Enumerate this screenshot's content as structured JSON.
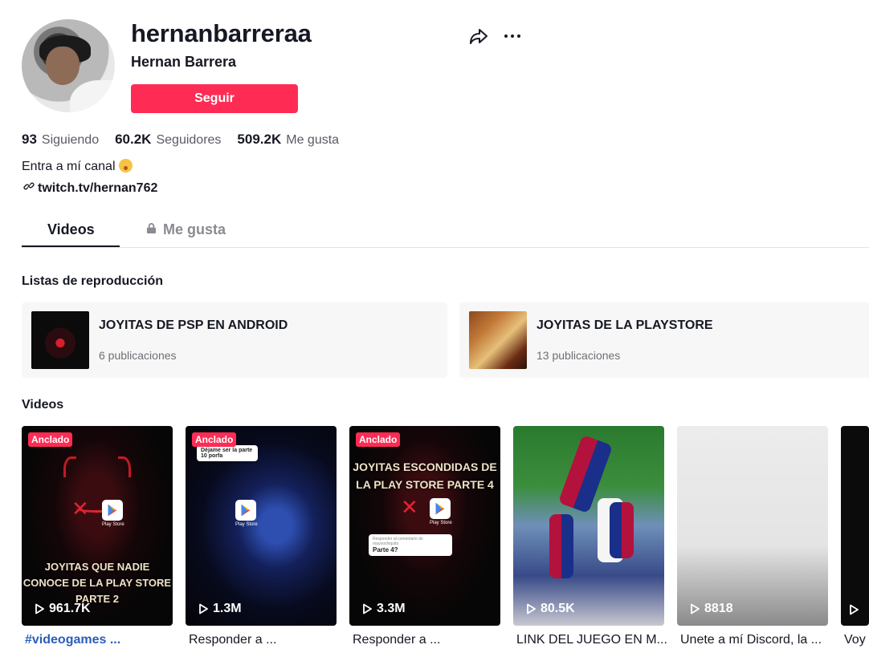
{
  "profile": {
    "username": "hernanbarreraa",
    "display_name": "Hernan Barrera",
    "follow_label": "Seguir",
    "stats": [
      {
        "value": "93",
        "label": "Siguiendo"
      },
      {
        "value": "60.2K",
        "label": "Seguidores"
      },
      {
        "value": "509.2K",
        "label": "Me gusta"
      }
    ],
    "bio": "Entra a mí canal",
    "link": "twitch.tv/hernan762"
  },
  "tabs": [
    {
      "label": "Videos",
      "active": true
    },
    {
      "label": "Me gusta",
      "locked": true
    }
  ],
  "playlists_section": "Listas de reproducción",
  "playlists": [
    {
      "name": "JOYITAS DE PSP EN ANDROID",
      "count": "6 publicaciones"
    },
    {
      "name": "JOYITAS DE LA PLAYSTORE",
      "count": "13 publicaciones"
    }
  ],
  "videos_section": "Videos",
  "videos": [
    {
      "views": "961.7K",
      "title": "#videogames ...",
      "pinned": "Anclado",
      "caption": "JOYITAS QUE NADIE CONOCE DE LA PLAY STORE PARTE 2",
      "store_label": "Play Store"
    },
    {
      "views": "1.3M",
      "title": "Responder a ...",
      "pinned": "Anclado",
      "comment_body": "Déjame ser la parte 10 porfa",
      "store_label": "Play Store"
    },
    {
      "views": "3.3M",
      "title": "Responder a ...",
      "pinned": "Anclado",
      "caption": "JOYITAS ESCONDIDAS DE LA PLAY STORE PARTE 4",
      "comment_head": "Responder al comentario de mayoochiquito",
      "comment_body": "Parte 4?",
      "store_label": "Play Store"
    },
    {
      "views": "80.5K",
      "title": "LINK DEL JUEGO EN M..."
    },
    {
      "views": "8818",
      "title": "Unete a mí Discord, la ..."
    },
    {
      "views": "",
      "title": "Voy"
    }
  ]
}
